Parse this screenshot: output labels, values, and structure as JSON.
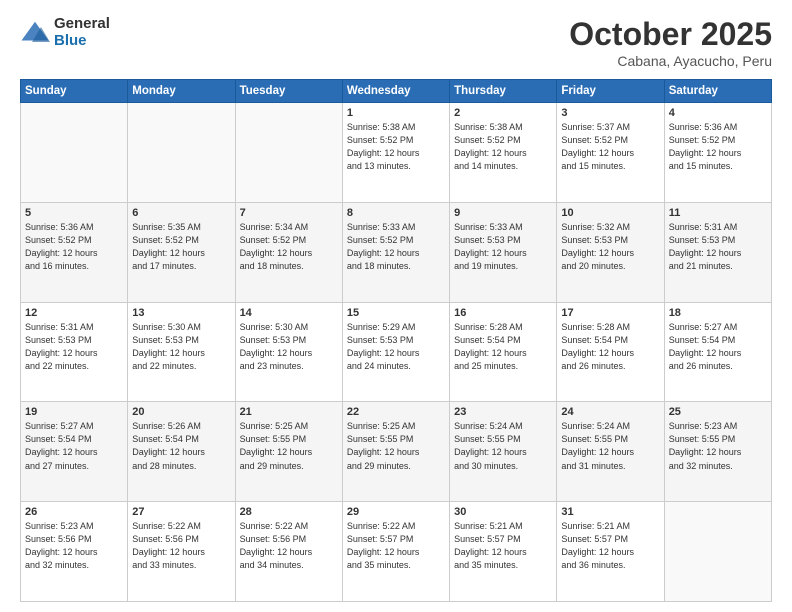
{
  "header": {
    "logo_general": "General",
    "logo_blue": "Blue",
    "month": "October 2025",
    "location": "Cabana, Ayacucho, Peru"
  },
  "weekdays": [
    "Sunday",
    "Monday",
    "Tuesday",
    "Wednesday",
    "Thursday",
    "Friday",
    "Saturday"
  ],
  "weeks": [
    [
      {
        "day": "",
        "info": ""
      },
      {
        "day": "",
        "info": ""
      },
      {
        "day": "",
        "info": ""
      },
      {
        "day": "1",
        "info": "Sunrise: 5:38 AM\nSunset: 5:52 PM\nDaylight: 12 hours\nand 13 minutes."
      },
      {
        "day": "2",
        "info": "Sunrise: 5:38 AM\nSunset: 5:52 PM\nDaylight: 12 hours\nand 14 minutes."
      },
      {
        "day": "3",
        "info": "Sunrise: 5:37 AM\nSunset: 5:52 PM\nDaylight: 12 hours\nand 15 minutes."
      },
      {
        "day": "4",
        "info": "Sunrise: 5:36 AM\nSunset: 5:52 PM\nDaylight: 12 hours\nand 15 minutes."
      }
    ],
    [
      {
        "day": "5",
        "info": "Sunrise: 5:36 AM\nSunset: 5:52 PM\nDaylight: 12 hours\nand 16 minutes."
      },
      {
        "day": "6",
        "info": "Sunrise: 5:35 AM\nSunset: 5:52 PM\nDaylight: 12 hours\nand 17 minutes."
      },
      {
        "day": "7",
        "info": "Sunrise: 5:34 AM\nSunset: 5:52 PM\nDaylight: 12 hours\nand 18 minutes."
      },
      {
        "day": "8",
        "info": "Sunrise: 5:33 AM\nSunset: 5:52 PM\nDaylight: 12 hours\nand 18 minutes."
      },
      {
        "day": "9",
        "info": "Sunrise: 5:33 AM\nSunset: 5:53 PM\nDaylight: 12 hours\nand 19 minutes."
      },
      {
        "day": "10",
        "info": "Sunrise: 5:32 AM\nSunset: 5:53 PM\nDaylight: 12 hours\nand 20 minutes."
      },
      {
        "day": "11",
        "info": "Sunrise: 5:31 AM\nSunset: 5:53 PM\nDaylight: 12 hours\nand 21 minutes."
      }
    ],
    [
      {
        "day": "12",
        "info": "Sunrise: 5:31 AM\nSunset: 5:53 PM\nDaylight: 12 hours\nand 22 minutes."
      },
      {
        "day": "13",
        "info": "Sunrise: 5:30 AM\nSunset: 5:53 PM\nDaylight: 12 hours\nand 22 minutes."
      },
      {
        "day": "14",
        "info": "Sunrise: 5:30 AM\nSunset: 5:53 PM\nDaylight: 12 hours\nand 23 minutes."
      },
      {
        "day": "15",
        "info": "Sunrise: 5:29 AM\nSunset: 5:53 PM\nDaylight: 12 hours\nand 24 minutes."
      },
      {
        "day": "16",
        "info": "Sunrise: 5:28 AM\nSunset: 5:54 PM\nDaylight: 12 hours\nand 25 minutes."
      },
      {
        "day": "17",
        "info": "Sunrise: 5:28 AM\nSunset: 5:54 PM\nDaylight: 12 hours\nand 26 minutes."
      },
      {
        "day": "18",
        "info": "Sunrise: 5:27 AM\nSunset: 5:54 PM\nDaylight: 12 hours\nand 26 minutes."
      }
    ],
    [
      {
        "day": "19",
        "info": "Sunrise: 5:27 AM\nSunset: 5:54 PM\nDaylight: 12 hours\nand 27 minutes."
      },
      {
        "day": "20",
        "info": "Sunrise: 5:26 AM\nSunset: 5:54 PM\nDaylight: 12 hours\nand 28 minutes."
      },
      {
        "day": "21",
        "info": "Sunrise: 5:25 AM\nSunset: 5:55 PM\nDaylight: 12 hours\nand 29 minutes."
      },
      {
        "day": "22",
        "info": "Sunrise: 5:25 AM\nSunset: 5:55 PM\nDaylight: 12 hours\nand 29 minutes."
      },
      {
        "day": "23",
        "info": "Sunrise: 5:24 AM\nSunset: 5:55 PM\nDaylight: 12 hours\nand 30 minutes."
      },
      {
        "day": "24",
        "info": "Sunrise: 5:24 AM\nSunset: 5:55 PM\nDaylight: 12 hours\nand 31 minutes."
      },
      {
        "day": "25",
        "info": "Sunrise: 5:23 AM\nSunset: 5:55 PM\nDaylight: 12 hours\nand 32 minutes."
      }
    ],
    [
      {
        "day": "26",
        "info": "Sunrise: 5:23 AM\nSunset: 5:56 PM\nDaylight: 12 hours\nand 32 minutes."
      },
      {
        "day": "27",
        "info": "Sunrise: 5:22 AM\nSunset: 5:56 PM\nDaylight: 12 hours\nand 33 minutes."
      },
      {
        "day": "28",
        "info": "Sunrise: 5:22 AM\nSunset: 5:56 PM\nDaylight: 12 hours\nand 34 minutes."
      },
      {
        "day": "29",
        "info": "Sunrise: 5:22 AM\nSunset: 5:57 PM\nDaylight: 12 hours\nand 35 minutes."
      },
      {
        "day": "30",
        "info": "Sunrise: 5:21 AM\nSunset: 5:57 PM\nDaylight: 12 hours\nand 35 minutes."
      },
      {
        "day": "31",
        "info": "Sunrise: 5:21 AM\nSunset: 5:57 PM\nDaylight: 12 hours\nand 36 minutes."
      },
      {
        "day": "",
        "info": ""
      }
    ]
  ]
}
